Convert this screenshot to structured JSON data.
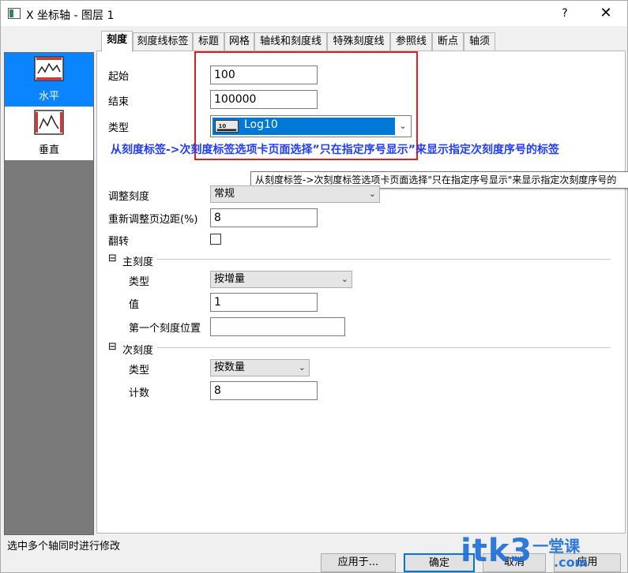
{
  "window": {
    "title": "X 坐标轴 - 图层 1",
    "help_label": "?",
    "close_label": "✕"
  },
  "sidebar": {
    "items": [
      {
        "label": "水平",
        "icon": "horizontal-axis-icon",
        "selected": true
      },
      {
        "label": "垂直",
        "icon": "vertical-axis-icon",
        "selected": false
      }
    ]
  },
  "tabs": [
    {
      "label": "刻度",
      "active": true
    },
    {
      "label": "刻度线标签"
    },
    {
      "label": "标题"
    },
    {
      "label": "网格"
    },
    {
      "label": "轴线和刻度线"
    },
    {
      "label": "特殊刻度线"
    },
    {
      "label": "参照线"
    },
    {
      "label": "断点"
    },
    {
      "label": "轴须"
    }
  ],
  "scale": {
    "from_label": "起始",
    "from_value": "100",
    "to_label": "结束",
    "to_value": "100000",
    "type_label": "类型",
    "type_value": "Log10",
    "rescale_label": "调整刻度",
    "rescale_value": "常规",
    "margin_label": "重新调整页边距(%)",
    "margin_value": "8",
    "reverse_label": "翻转"
  },
  "annotation": {
    "note": "从刻度标签->次刻度标签选项卡页面选择”只在指定序号显示”来显示指定次刻度序号的标签",
    "tooltip": "从刻度标签->次刻度标签选项卡页面选择\"只在指定序号显示\"来显示指定次刻度序号的"
  },
  "major": {
    "header": "主刻度",
    "toggle": "⊟",
    "type_label": "类型",
    "type_value": "按增量",
    "value_label": "值",
    "value": "1",
    "first_tick_label": "第一个刻度位置",
    "first_tick_value": ""
  },
  "minor": {
    "header": "次刻度",
    "toggle": "⊟",
    "type_label": "类型",
    "type_value": "按数量",
    "count_label": "计数",
    "count_value": "8"
  },
  "status": "选中多个轴同时进行修改",
  "buttons": {
    "apply_to": "应用于...",
    "ok": "确定",
    "cancel": "取消",
    "apply": "应用"
  },
  "watermark": {
    "main": "itk3",
    "suffix": "一堂课",
    "domain": ".com"
  },
  "colors": {
    "selection": "#0078d7",
    "highlight_box": "#e02020",
    "note_text": "#1f3cff",
    "watermark": "#1e6fd9"
  }
}
